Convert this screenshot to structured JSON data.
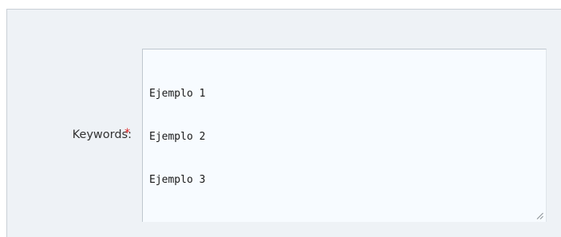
{
  "form": {
    "keywords": {
      "label": "Keywords:",
      "required_marker": "*",
      "value_lines": [
        "Ejemplo 1",
        "Ejemplo 2",
        "Ejemplo 3"
      ]
    }
  },
  "colors": {
    "panel_background": "#eef2f6",
    "textarea_background": "#f7fbff",
    "required_marker": "#e02020"
  },
  "icons": {
    "resize_grip": "resize-grip-icon"
  }
}
